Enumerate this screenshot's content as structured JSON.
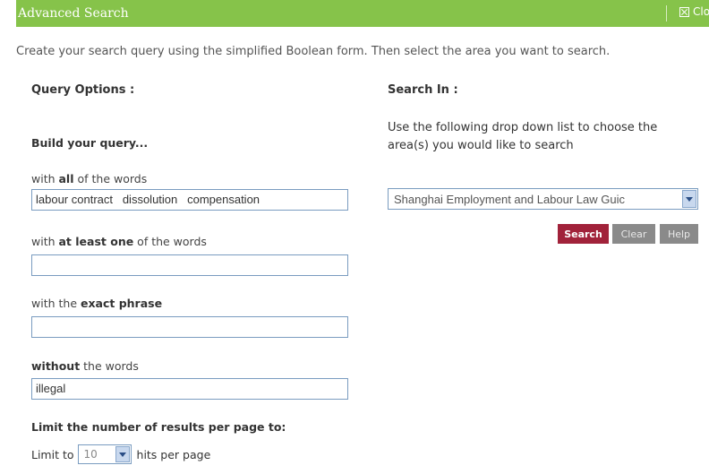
{
  "window": {
    "title": "Advanced Search",
    "close_label": "Close"
  },
  "intro": "Create your search query using the simplified Boolean form. Then select the area you want to search.",
  "query_options": {
    "heading": "Query Options :",
    "subheading": "Build your query...",
    "all_words": {
      "prefix": "with ",
      "bold": "all",
      "suffix": " of the words",
      "value": "labour contract   dissolution   compensation"
    },
    "at_least_one": {
      "prefix": "with ",
      "bold": "at least one",
      "suffix": " of the words",
      "value": ""
    },
    "exact_phrase": {
      "prefix": "with the ",
      "bold": "exact phrase",
      "suffix": "",
      "value": ""
    },
    "without": {
      "prefix": "",
      "bold": "without",
      "suffix": " the words",
      "value": "illegal"
    }
  },
  "limit": {
    "heading": "Limit the number of results per page to:",
    "prefix": "Limit to",
    "value": "10",
    "suffix": "hits per page"
  },
  "search_in": {
    "heading": "Search In :",
    "description": "Use the following drop down list to choose the area(s) you would like to search",
    "selected": "Shanghai Employment and Labour Law Guic"
  },
  "buttons": {
    "search": "Search",
    "clear": "Clear",
    "help": "Help"
  },
  "colors": {
    "titlebar": "#86c34a",
    "search_button": "#a1223a",
    "secondary_button": "#8a8a8a",
    "field_border": "#7a9cc0"
  }
}
